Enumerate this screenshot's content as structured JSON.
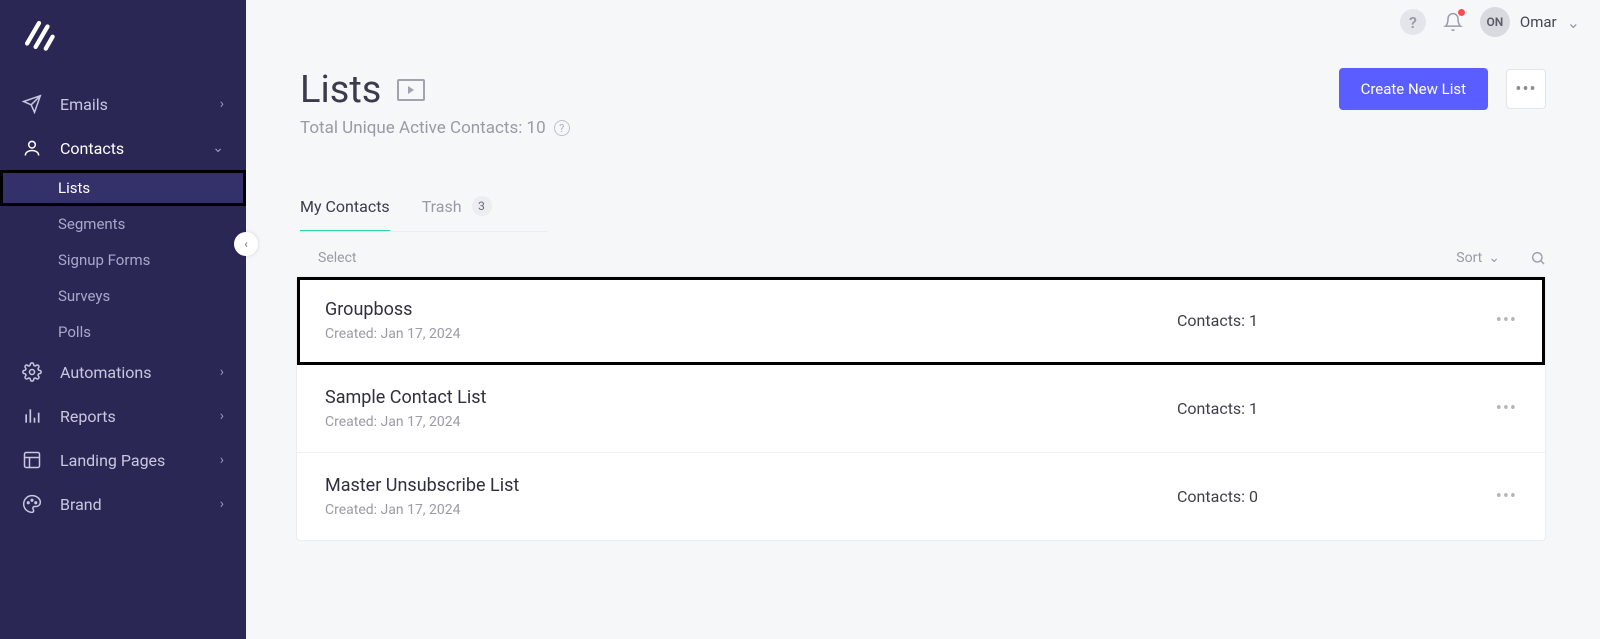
{
  "user": {
    "initials": "ON",
    "name": "Omar"
  },
  "sidebar": {
    "items": [
      {
        "label": "Emails"
      },
      {
        "label": "Contacts"
      },
      {
        "label": "Automations"
      },
      {
        "label": "Reports"
      },
      {
        "label": "Landing Pages"
      },
      {
        "label": "Brand"
      }
    ],
    "contacts_sub": [
      {
        "label": "Lists"
      },
      {
        "label": "Segments"
      },
      {
        "label": "Signup Forms"
      },
      {
        "label": "Surveys"
      },
      {
        "label": "Polls"
      }
    ]
  },
  "page": {
    "title": "Lists",
    "subtitle": "Total Unique Active Contacts: 10",
    "create_button": "Create New List",
    "tabs": [
      {
        "label": "My Contacts"
      },
      {
        "label": "Trash",
        "badge": "3"
      }
    ],
    "select_label": "Select",
    "sort_label": "Sort"
  },
  "lists": [
    {
      "name": "Groupboss",
      "created": "Created: Jan 17, 2024",
      "contacts": "Contacts: 1"
    },
    {
      "name": "Sample Contact List",
      "created": "Created: Jan 17, 2024",
      "contacts": "Contacts: 1"
    },
    {
      "name": "Master Unsubscribe List",
      "created": "Created: Jan 17, 2024",
      "contacts": "Contacts: 0"
    }
  ]
}
